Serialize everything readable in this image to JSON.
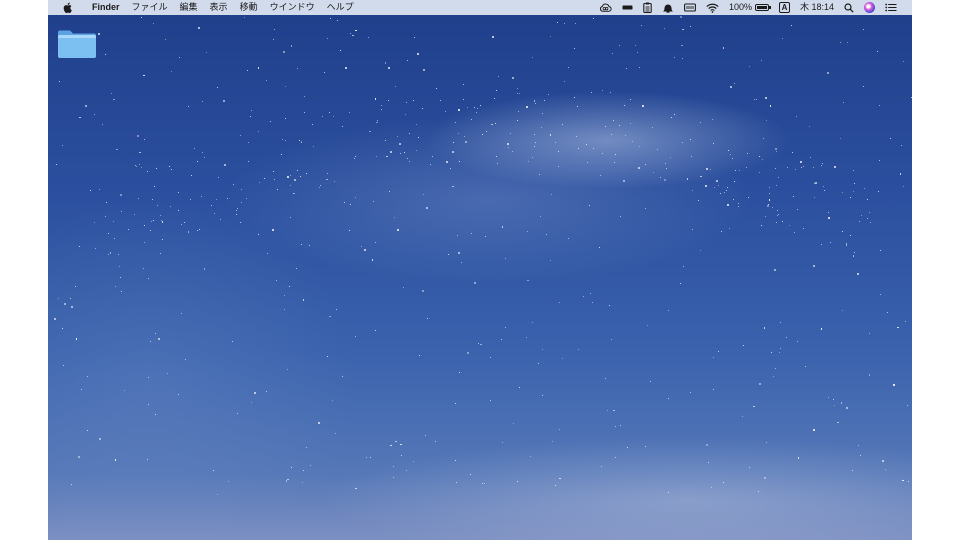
{
  "menubar": {
    "apple_icon": "apple-logo-icon",
    "app_name": "Finder",
    "menus": [
      "ファイル",
      "編集",
      "表示",
      "移動",
      "ウインドウ",
      "ヘルプ"
    ],
    "status": {
      "icons": [
        "creative-cloud-icon",
        "display-icon",
        "clipboard-icon",
        "notification-bell-icon",
        "keyboard-icon",
        "wifi-icon"
      ],
      "battery_percent": "100%",
      "battery_level": 1.0,
      "input_source": "A",
      "clock": "木 18:14",
      "search_icon": "spotlight-search-icon",
      "siri_icon": "siri-icon",
      "notification_center_icon": "notification-center-icon"
    }
  },
  "desktop": {
    "wallpaper": "starry-night-sky",
    "icons": [
      {
        "name": "folder-icon",
        "label": ""
      }
    ]
  },
  "colors": {
    "menubar_bg": "#e2e8f4",
    "sky_top": "#1f3e8a",
    "sky_bottom": "#7d90c2",
    "folder": "#6fb3ea"
  }
}
